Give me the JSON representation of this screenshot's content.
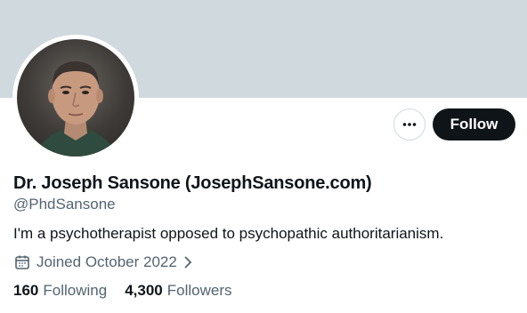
{
  "profile": {
    "name": "Dr. Joseph Sansone (JosephSansone.com)",
    "handle": "@PhdSansone",
    "bio": "I'm a psychotherapist opposed to psychopathic authoritarianism.",
    "joined": "Joined October 2022",
    "following_count": "160",
    "following_label": "Following",
    "followers_count": "4,300",
    "followers_label": "Followers"
  },
  "actions": {
    "follow_label": "Follow",
    "more_icon": "more-horizontal-icon"
  },
  "icons": {
    "calendar": "calendar-icon",
    "chevron": "chevron-right-icon"
  },
  "colors": {
    "banner": "#cfd9de",
    "primary_text": "#0f1419",
    "secondary_text": "#536471",
    "follow_bg": "#0f1419"
  }
}
